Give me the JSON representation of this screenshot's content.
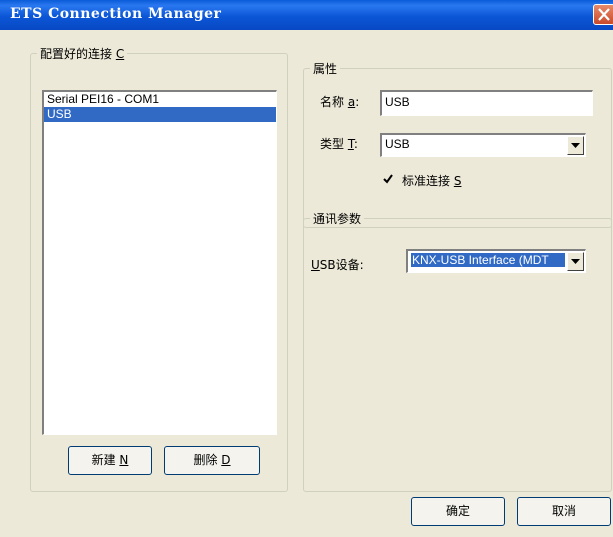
{
  "window": {
    "title": "ETS Connection Manager"
  },
  "connections_group": {
    "legend": "配置好的连接 ",
    "legend_key": "C",
    "items": [
      "Serial PEI16 - COM1",
      "USB"
    ],
    "selected": "USB",
    "new_label": "新建 ",
    "new_key": "N",
    "delete_label": "删除 ",
    "delete_key": "D"
  },
  "properties_group": {
    "legend": "属性",
    "name_label": "名称 ",
    "name_key": "a",
    "name_colon": ":",
    "name_value": "USB",
    "type_label": "类型 ",
    "type_key": "T",
    "type_colon": ":",
    "type_value": "USB",
    "standard_checked": true,
    "standard_label": "标准连接 ",
    "standard_key": "S"
  },
  "comm_group": {
    "legend": "通讯参数",
    "device_key": "U",
    "device_label_rest": "SB设备:",
    "device_value": "KNX-USB Interface (MDT"
  },
  "footer": {
    "ok_label": "确定",
    "cancel_label": "取消"
  }
}
